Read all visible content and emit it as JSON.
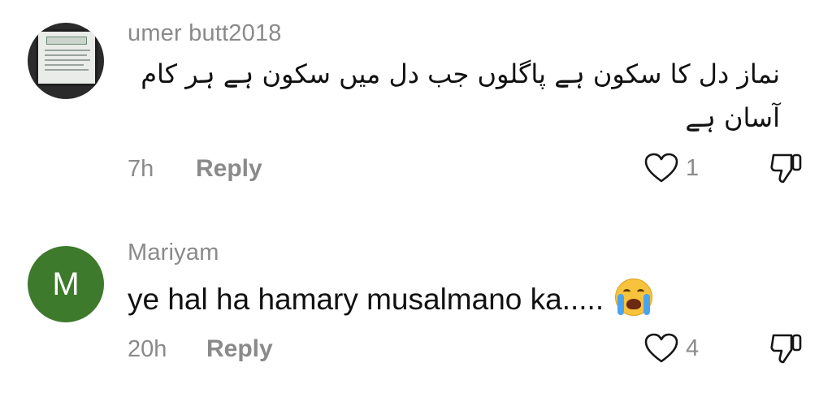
{
  "comments": [
    {
      "username": "umer butt2018",
      "text_lines": [
        "نماز دل کا سکون ہے پاگلوں جب دل میں سکون ہے ہر کام",
        "آسان ہے"
      ],
      "time": "7h",
      "reply_label": "Reply",
      "like_count": "1",
      "avatar_type": "photo"
    },
    {
      "username": "Mariyam",
      "avatar_initial": "M",
      "text": "ye hal ha hamary musalmano ka.....",
      "emoji": "loudly-crying-face",
      "time": "20h",
      "reply_label": "Reply",
      "like_count": "4",
      "avatar_color": "#3e7a2c"
    }
  ],
  "icons": {
    "like": "heart-outline-icon",
    "dislike": "thumbs-down-outline-icon"
  },
  "colors": {
    "secondary_text": "#8a8a8a",
    "primary_text": "#111111"
  }
}
